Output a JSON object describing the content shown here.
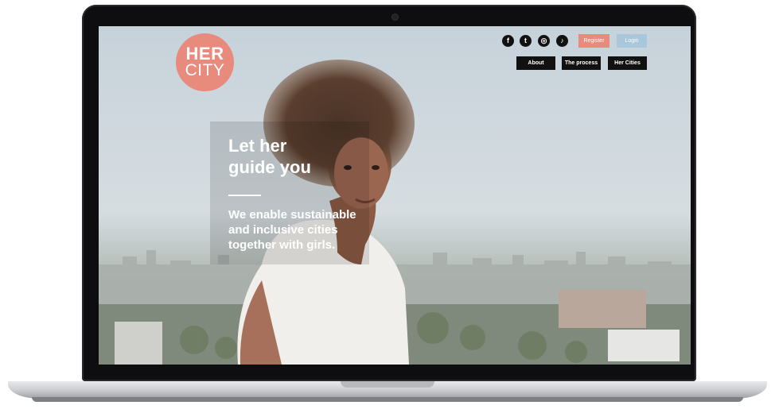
{
  "brand": {
    "line1": "HER",
    "line2": "CITY"
  },
  "social": [
    {
      "icon": "facebook-icon",
      "glyph": "f"
    },
    {
      "icon": "twitter-icon",
      "glyph": "t"
    },
    {
      "icon": "instagram-icon",
      "glyph": "◎"
    },
    {
      "icon": "tiktok-icon",
      "glyph": "♪"
    }
  ],
  "auth": {
    "register": "Register",
    "login": "Login"
  },
  "nav": [
    "About",
    "The process",
    "Her Cities"
  ],
  "hero": {
    "headline_1": "Let her",
    "headline_2": "guide you",
    "tagline_1": "We enable sustainable",
    "tagline_2": "and inclusive cities",
    "tagline_3": "together with girls."
  },
  "colors": {
    "accent": "#e88a7c",
    "login": "#a8c7db",
    "nav": "#111111"
  }
}
